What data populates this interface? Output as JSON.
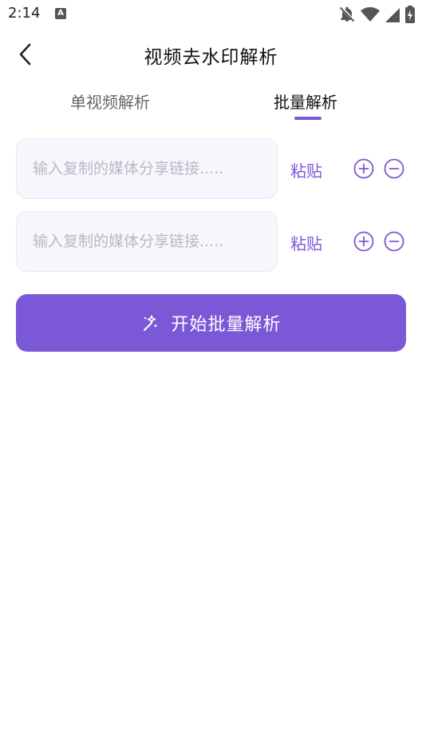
{
  "status_bar": {
    "time": "2:14",
    "a_icon": "A"
  },
  "header": {
    "title": "视频去水印解析"
  },
  "tabs": [
    {
      "label": "单视频解析",
      "active": false
    },
    {
      "label": "批量解析",
      "active": true
    }
  ],
  "rows": [
    {
      "placeholder": "输入复制的媒体分享链接.....",
      "value": "",
      "paste_label": "粘贴"
    },
    {
      "placeholder": "输入复制的媒体分享链接.....",
      "value": "",
      "paste_label": "粘贴"
    }
  ],
  "start_button": {
    "label": "开始批量解析",
    "icon": "magic-wand-icon"
  },
  "colors": {
    "accent": "#7b58d6",
    "input_bg": "#f6f7fc",
    "placeholder": "#b8b9c4"
  }
}
